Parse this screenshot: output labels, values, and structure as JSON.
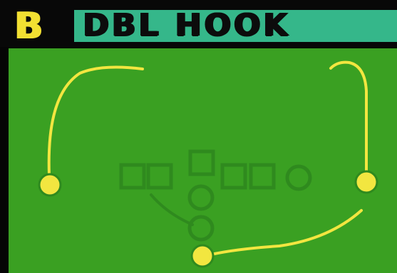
{
  "play": {
    "slot": "B",
    "name": "DBL HOOK"
  },
  "colors": {
    "field": "#3aa022",
    "route": "#f2e640",
    "lineman": "#2f8a1e",
    "title_bar": "#35b78a",
    "slot_letter": "#f2df32"
  },
  "players": {
    "receivers": [
      "left-wide-receiver",
      "right-wide-receiver",
      "running-back"
    ],
    "offensive_line": [
      "left-tackle",
      "left-guard",
      "center",
      "right-guard",
      "right-tackle"
    ],
    "tight_end": "tight-end",
    "backfield": [
      "quarterback",
      "fullback"
    ]
  },
  "routes": [
    "left-receiver-hook-route",
    "right-receiver-hook-route",
    "running-back-flat-route",
    "fullback-block-arc"
  ]
}
